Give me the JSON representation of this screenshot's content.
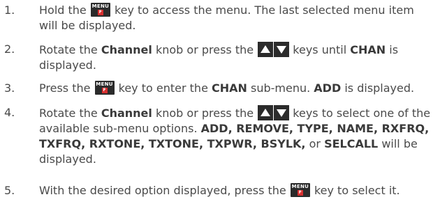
{
  "key_icon": {
    "label": "MENU",
    "sub": "F"
  },
  "steps": [
    {
      "number": "1.",
      "t1": "Hold the",
      "t2": "key to access the menu. The last selected menu item will be displayed."
    },
    {
      "number": "2.",
      "t1": "Rotate the",
      "b1": "Channel",
      "t2": "knob or press the",
      "t3": "keys until",
      "b2": "CHAN",
      "t4": "is displayed."
    },
    {
      "number": "3.",
      "t1": "Press the",
      "t2": "key to enter the",
      "b1": "CHAN",
      "t3": "sub-menu.",
      "b2": "ADD",
      "t4": "is displayed."
    },
    {
      "number": "4.",
      "t1": "Rotate the",
      "b1": "Channel",
      "t2": "knob or press the",
      "t3": "keys to select one of the available sub-menu options.",
      "b2": "ADD, REMOVE, TYPE, NAME, RXFRQ, TXFRQ, RXTONE, TXTONE, TXPWR, BSYLK,",
      "t4": "or",
      "b3": "SELCALL",
      "t5": "will be displayed."
    },
    {
      "number": "5.",
      "t1": "With the desired option displayed, press the",
      "t2": "key to select it."
    }
  ]
}
